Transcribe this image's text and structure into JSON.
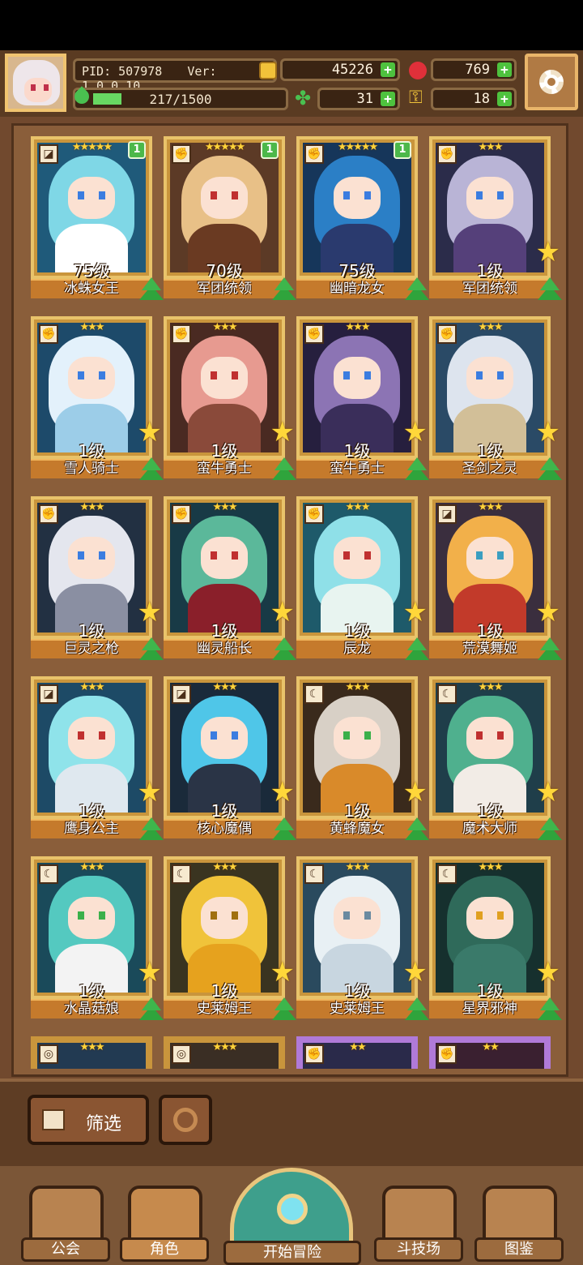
{
  "header": {
    "pid": "PID: 507978",
    "version": "Ver: 1.0.0.10",
    "energy": "217/1500",
    "energy_fraction": 0.145,
    "gold": "45226",
    "ruby": "769",
    "clover": "31",
    "key": "18"
  },
  "heroes": [
    {
      "name": "冰蛛女王",
      "level": "75级",
      "stars": "★★★★★",
      "badge": "1",
      "cls": "◪",
      "hair": "#7fd7e6",
      "body": "#ffffff",
      "bg": "#1f5a7a",
      "eye": "#3b7de0"
    },
    {
      "name": "军团统领",
      "level": "70级",
      "stars": "★★★★★",
      "badge": "1",
      "cls": "✊",
      "hair": "#e8c087",
      "body": "#6a3a22",
      "bg": "#5c3a26",
      "eye": "#c03030"
    },
    {
      "name": "幽暗龙女",
      "level": "75级",
      "stars": "★★★★★",
      "badge": "1",
      "cls": "✊",
      "hair": "#2b7fc6",
      "body": "#2a3a6e",
      "bg": "#16365a",
      "eye": "#3b7de0"
    },
    {
      "name": "军团统领",
      "level": "1级",
      "stars": "★★★",
      "badge": "",
      "cls": "✊",
      "hair": "#b9b4d6",
      "body": "#55407a",
      "bg": "#2b2c4a",
      "eye": "#3b7de0"
    },
    {
      "name": "雪人骑士",
      "level": "1级",
      "stars": "★★★",
      "badge": "",
      "cls": "✊",
      "hair": "#e3f1fb",
      "body": "#9ccde8",
      "bg": "#1d4a6a",
      "eye": "#3b7de0"
    },
    {
      "name": "蛮牛勇士",
      "level": "1级",
      "stars": "★★★",
      "badge": "",
      "cls": "✊",
      "hair": "#e79a90",
      "body": "#8a4a3a",
      "bg": "#4a2a22",
      "eye": "#c03030"
    },
    {
      "name": "蛮牛勇士",
      "level": "1级",
      "stars": "★★★",
      "badge": "",
      "cls": "✊",
      "hair": "#8c74b4",
      "body": "#3a2e5a",
      "bg": "#261f3e",
      "eye": "#3b7de0"
    },
    {
      "name": "圣剑之灵",
      "level": "1级",
      "stars": "★★★",
      "badge": "",
      "cls": "✊",
      "hair": "#dde4ee",
      "body": "#d2bf98",
      "bg": "#2a4a66",
      "eye": "#3b7de0"
    },
    {
      "name": "巨灵之枪",
      "level": "1级",
      "stars": "★★★",
      "badge": "",
      "cls": "✊",
      "hair": "#e4e6ee",
      "body": "#8a8fa2",
      "bg": "#223042",
      "eye": "#3b7de0"
    },
    {
      "name": "幽灵船长",
      "level": "1级",
      "stars": "★★★",
      "badge": "",
      "cls": "✊",
      "hair": "#5bb89a",
      "body": "#8a1f2a",
      "bg": "#183a46",
      "eye": "#c03030"
    },
    {
      "name": "辰龙",
      "level": "1级",
      "stars": "★★★",
      "badge": "",
      "cls": "✊",
      "hair": "#8fe0e8",
      "body": "#e8f4f0",
      "bg": "#1e5a6a",
      "eye": "#c03030"
    },
    {
      "name": "荒漠舞姬",
      "level": "1级",
      "stars": "★★★",
      "badge": "",
      "cls": "◪",
      "hair": "#f2b04a",
      "body": "#c23a2a",
      "bg": "#3a2e3e",
      "eye": "#3b9ec0"
    },
    {
      "name": "鹰身公主",
      "level": "1级",
      "stars": "★★★",
      "badge": "",
      "cls": "◪",
      "hair": "#8fe3ea",
      "body": "#dfe8ef",
      "bg": "#1d4a66",
      "eye": "#c03030"
    },
    {
      "name": "核心魔偶",
      "level": "1级",
      "stars": "★★★",
      "badge": "",
      "cls": "◪",
      "hair": "#4fc6e8",
      "body": "#2a3446",
      "bg": "#1a2a3a",
      "eye": "#3b7de0"
    },
    {
      "name": "黄蜂魔女",
      "level": "1级",
      "stars": "★★★",
      "badge": "",
      "cls": "☾",
      "hair": "#d8d0c6",
      "body": "#d98a2a",
      "bg": "#3a2a1c",
      "eye": "#3bb04a"
    },
    {
      "name": "魔术大师",
      "level": "1级",
      "stars": "★★★",
      "badge": "",
      "cls": "☾",
      "hair": "#4fb08e",
      "body": "#f2ece6",
      "bg": "#1f3e4a",
      "eye": "#c03030"
    },
    {
      "name": "水晶菇娘",
      "level": "1级",
      "stars": "★★★",
      "badge": "",
      "cls": "☾",
      "hair": "#54c9c0",
      "body": "#f3f3f3",
      "bg": "#1a4a5a",
      "eye": "#3bb04a"
    },
    {
      "name": "史莱姆王",
      "level": "1级",
      "stars": "★★★",
      "badge": "",
      "cls": "☾",
      "hair": "#f0c33a",
      "body": "#e6a21e",
      "bg": "#3a3420",
      "eye": "#a07010"
    },
    {
      "name": "史莱姆王",
      "level": "1级",
      "stars": "★★★",
      "badge": "",
      "cls": "☾",
      "hair": "#e8f0f4",
      "body": "#c8d6e0",
      "bg": "#2a4a5e",
      "eye": "#6a8aa0"
    },
    {
      "name": "星界邪神",
      "level": "1级",
      "stars": "★★★",
      "badge": "",
      "cls": "☾",
      "hair": "#2f6a5a",
      "body": "#3a7a6a",
      "bg": "#16302e",
      "eye": "#e0a020"
    }
  ],
  "partial_row": [
    {
      "stars": "★★★",
      "cls": "◎",
      "bg": "#223a52",
      "frame": "#c9953c"
    },
    {
      "stars": "★★★",
      "cls": "◎",
      "bg": "#3a2e24",
      "frame": "#c9953c"
    },
    {
      "stars": "★★",
      "cls": "✊",
      "bg": "#2a2a4a",
      "frame": "#b07ad8"
    },
    {
      "stars": "★★",
      "cls": "✊",
      "bg": "#3a2030",
      "frame": "#b07ad8"
    }
  ],
  "toolbar": {
    "filter_label": "筛选"
  },
  "nav": {
    "guild": "公会",
    "character": "角色",
    "adventure": "开始冒险",
    "arena": "斗技场",
    "codex": "图鉴"
  }
}
